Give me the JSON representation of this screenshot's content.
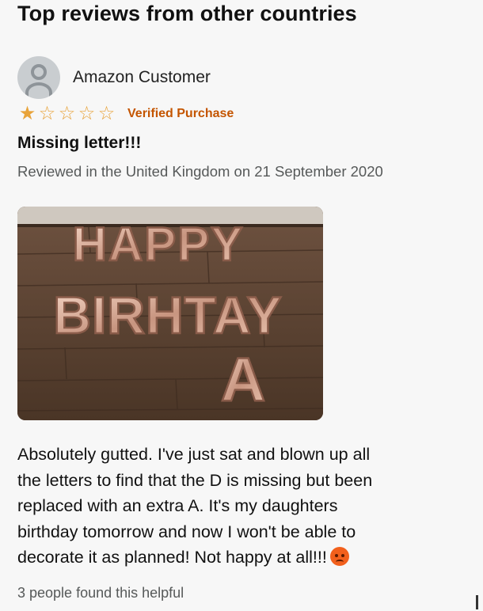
{
  "section": {
    "title": "Top reviews from other countries"
  },
  "review": {
    "reviewer_name": "Amazon Customer",
    "rating": 1,
    "max_rating": 5,
    "stars": [
      "★",
      "☆",
      "☆",
      "☆",
      "☆"
    ],
    "star_color": "#e8a33a",
    "verified_label": "Verified Purchase",
    "verified_color": "#c45500",
    "title": "Missing letter!!!",
    "meta": "Reviewed in the United Kingdom on 21 September 2020",
    "photo": {
      "icon": "balloon-letters-photo",
      "line1": "HAPPY",
      "line2": "BIRHTAY",
      "line3": "A"
    },
    "body_lines": [
      "Absolutely gutted. I've just sat and blown up all",
      "the letters to find that the D is missing but been",
      "replaced with an extra A. It's my daughters",
      "birthday tomorrow and now I won't be able to",
      "decorate it as planned! Not happy at all!!!"
    ],
    "body_emoji": "angry-face-icon",
    "helpful_text": "3 people found this helpful"
  }
}
